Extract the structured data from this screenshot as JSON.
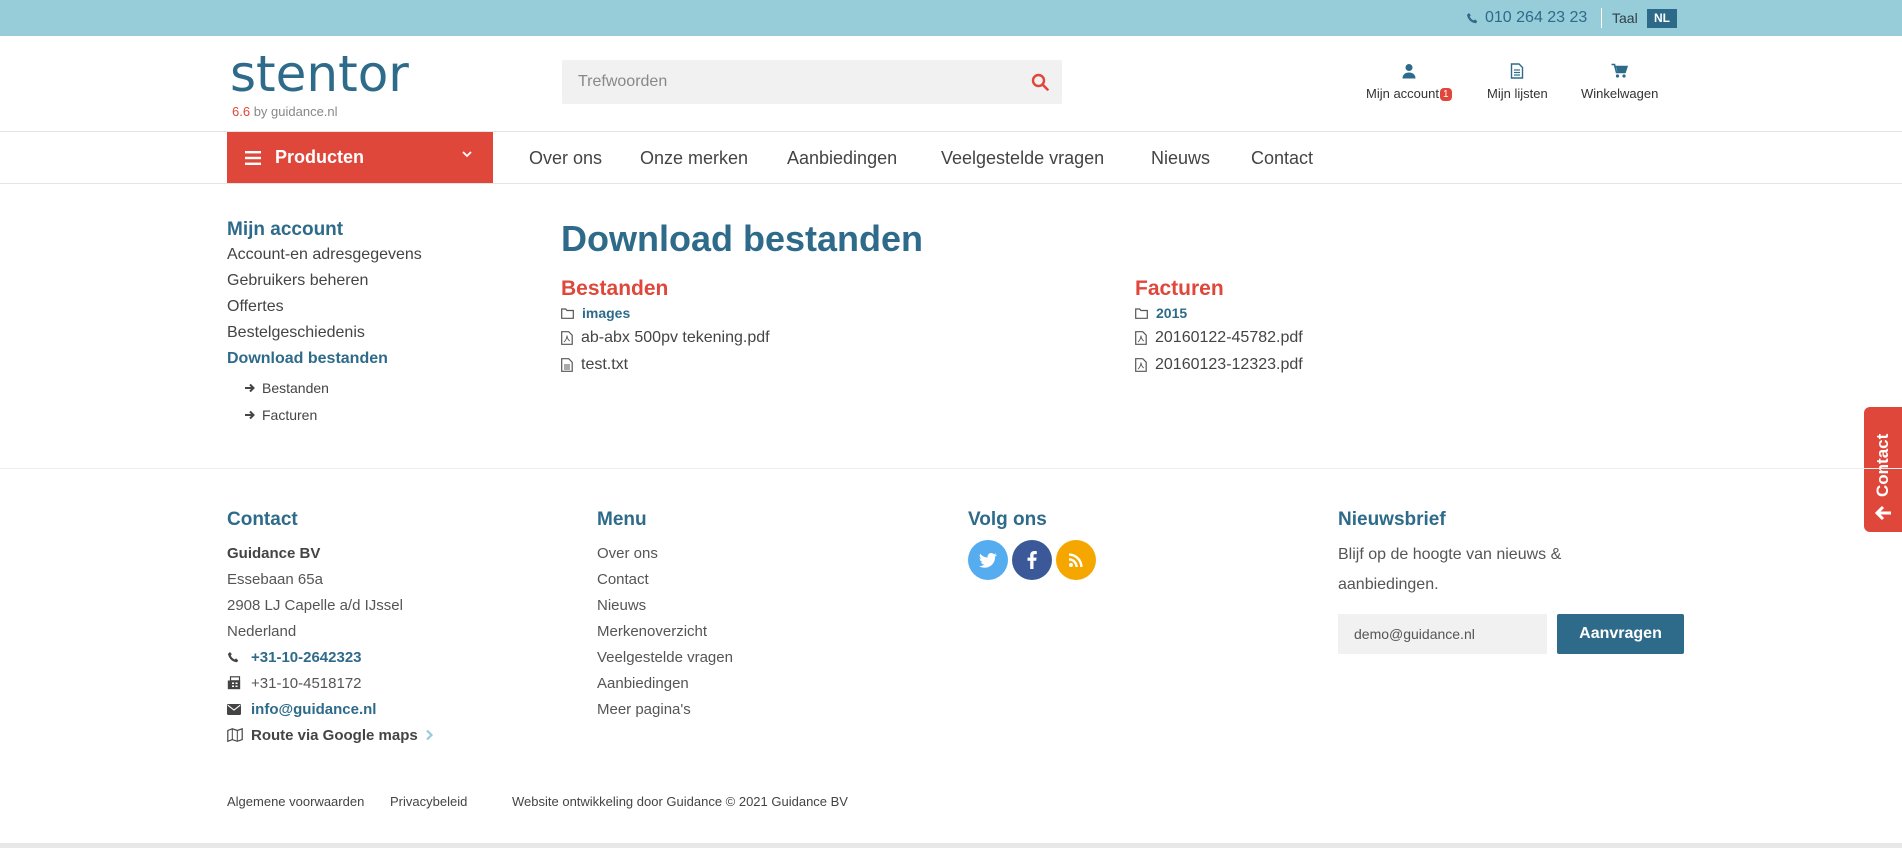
{
  "topbar": {
    "phone": "010 264 23 23",
    "lang_label": "Taal",
    "lang_code": "NL"
  },
  "header": {
    "logo_text": "stentor",
    "logo_version": "6.6",
    "logo_by": " by guidance.nl",
    "search_placeholder": "Trefwoorden",
    "account_label": "Mijn account",
    "account_badge": "1",
    "lists_label": "Mijn lijsten",
    "cart_label": "Winkelwagen"
  },
  "nav": {
    "products_label": "Producten",
    "items": [
      "Over ons",
      "Onze merken",
      "Aanbiedingen",
      "Veelgestelde vragen",
      "Nieuws",
      "Contact"
    ]
  },
  "sidebar": {
    "title": "Mijn account",
    "links": [
      "Account-en adresgegevens",
      "Gebruikers beheren",
      "Offertes",
      "Bestelgeschiedenis",
      "Download bestanden"
    ],
    "sublinks": [
      "Bestanden",
      "Facturen"
    ]
  },
  "main": {
    "title": "Download bestanden",
    "files": {
      "heading": "Bestanden",
      "folder": "images",
      "items": [
        "ab-abx 500pv tekening.pdf",
        "test.txt"
      ]
    },
    "invoices": {
      "heading": "Facturen",
      "folder": "2015",
      "items": [
        "20160122-45782.pdf",
        "20160123-12323.pdf"
      ]
    }
  },
  "contact_tab": {
    "label": "Contact"
  },
  "footer": {
    "contact": {
      "heading": "Contact",
      "company": "Guidance BV",
      "street": "Essebaan 65a",
      "city": "2908 LJ Capelle a/d IJssel",
      "country": "Nederland",
      "phone": "+31-10-2642323",
      "fax": "+31-10-4518172",
      "email": "info@guidance.nl",
      "route": "Route via Google maps"
    },
    "menu": {
      "heading": "Menu",
      "items": [
        "Over ons",
        "Contact",
        "Nieuws",
        "Merkenoverzicht",
        "Veelgestelde vragen",
        "Aanbiedingen",
        "Meer pagina's"
      ]
    },
    "follow": {
      "heading": "Volg ons"
    },
    "newsletter": {
      "heading": "Nieuwsbrief",
      "text": "Blijf op de hoogte van nieuws & aanbiedingen.",
      "email_value": "demo@guidance.nl",
      "button": "Aanvragen"
    },
    "bottom": {
      "terms": "Algemene voorwaarden",
      "privacy": "Privacybeleid",
      "credit": "Website ontwikkeling door Guidance © 2021 Guidance BV"
    }
  },
  "colors": {
    "topbar_bg": "#97ccd9",
    "primary_blue": "#2e6b8a",
    "accent_red": "#e0473b",
    "twitter": "#55acee",
    "facebook": "#3b5998",
    "rss": "#f5a700"
  },
  "icons": [
    "phone-icon",
    "search-icon",
    "user-icon",
    "list-icon",
    "cart-icon",
    "menu-icon",
    "chevron-down-icon",
    "arrow-right-icon",
    "folder-icon",
    "pdf-file-icon",
    "text-file-icon",
    "arrow-left-icon",
    "fax-icon",
    "envelope-icon",
    "map-icon",
    "chevron-right-icon",
    "twitter-icon",
    "facebook-icon",
    "rss-icon"
  ]
}
